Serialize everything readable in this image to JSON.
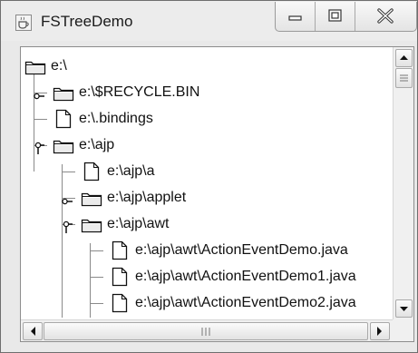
{
  "window": {
    "title": "FSTreeDemo",
    "icon": "java-coffee-cup-icon",
    "buttons": [
      "minimize-icon",
      "maximize-icon",
      "close-icon"
    ]
  },
  "tree": {
    "nodes": [
      {
        "label": "e:\\",
        "type": "folder",
        "depth": 0,
        "expanded": true,
        "has_handle": false
      },
      {
        "label": "e:\\$RECYCLE.BIN",
        "type": "folder",
        "depth": 1,
        "expanded": false,
        "has_handle": true
      },
      {
        "label": "e:\\.bindings",
        "type": "file",
        "depth": 1,
        "has_handle": false
      },
      {
        "label": "e:\\ajp",
        "type": "folder",
        "depth": 1,
        "expanded": true,
        "has_handle": true
      },
      {
        "label": "e:\\ajp\\a",
        "type": "file",
        "depth": 2,
        "has_handle": false
      },
      {
        "label": "e:\\ajp\\applet",
        "type": "folder",
        "depth": 2,
        "expanded": false,
        "has_handle": true
      },
      {
        "label": "e:\\ajp\\awt",
        "type": "folder",
        "depth": 2,
        "expanded": true,
        "has_handle": true
      },
      {
        "label": "e:\\ajp\\awt\\ActionEventDemo.java",
        "type": "file",
        "depth": 3,
        "has_handle": false
      },
      {
        "label": "e:\\ajp\\awt\\ActionEventDemo1.java",
        "type": "file",
        "depth": 3,
        "has_handle": false
      },
      {
        "label": "e:\\ajp\\awt\\ActionEventDemo2.java",
        "type": "file",
        "depth": 3,
        "has_handle": false
      },
      {
        "label": "",
        "type": "file",
        "depth": 3,
        "has_handle": false
      }
    ]
  },
  "scrollbars": {
    "vertical_position": 0.0,
    "horizontal_position": 0.0
  }
}
